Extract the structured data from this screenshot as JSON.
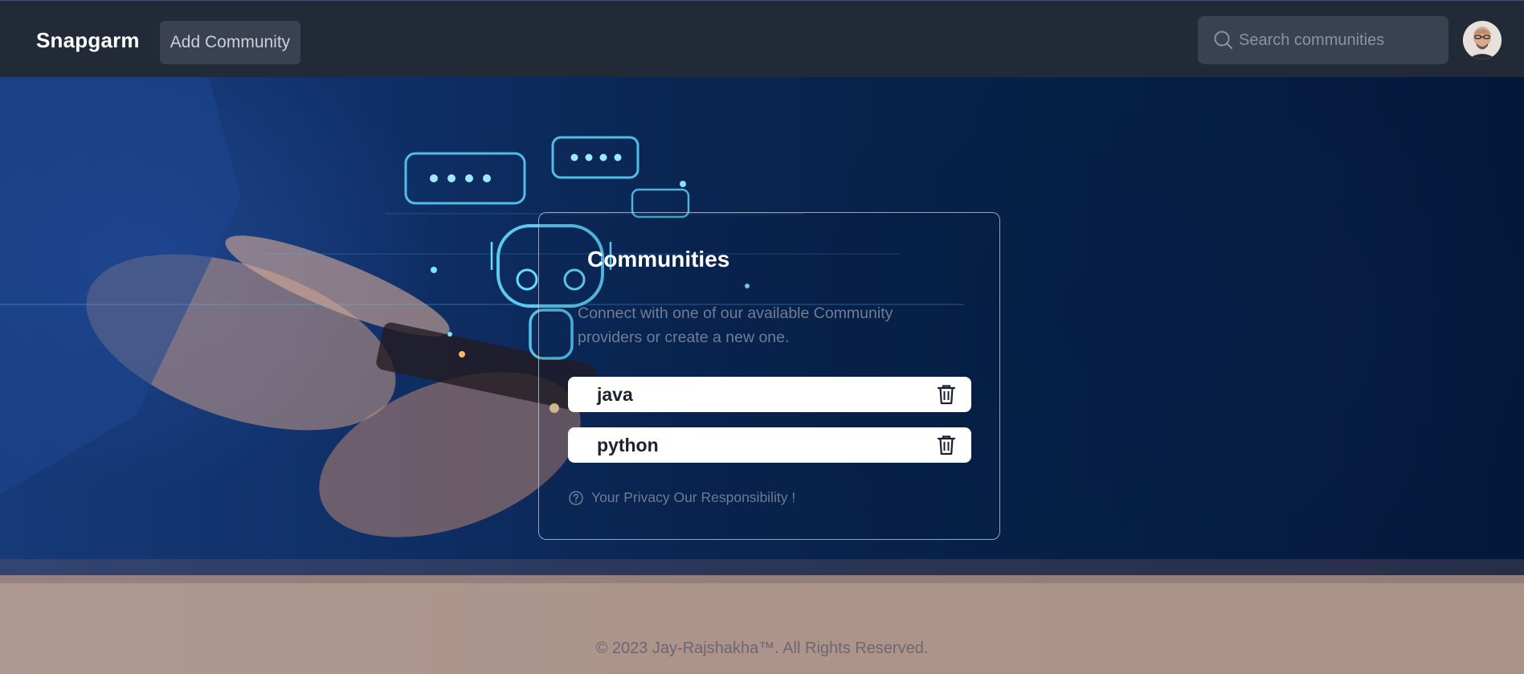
{
  "header": {
    "brand": "Snapgarm",
    "add_button": "Add Community",
    "search_placeholder": "Search communities",
    "avatar_icon": "user-avatar"
  },
  "card": {
    "title": "Communities",
    "description": "Connect with one of our available Community providers or create a new one.",
    "communities": [
      {
        "name": "java",
        "action_icon": "trash-icon"
      },
      {
        "name": "python",
        "action_icon": "trash-icon"
      }
    ],
    "privacy_icon": "question-circle-icon",
    "privacy_text": "Your Privacy Our Responsibility !"
  },
  "footer": {
    "text": "© 2023 Jay-Rajshakha™. All Rights Reserved."
  },
  "colors": {
    "header_bg": "#222a38",
    "control_bg": "#3a4252",
    "card_border": "#c8d2e6",
    "item_bg": "#ffffff",
    "hero_blue": "#0a2552"
  }
}
